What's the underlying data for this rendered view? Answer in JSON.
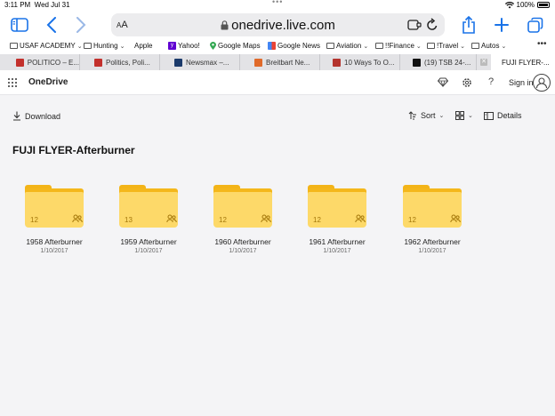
{
  "status": {
    "time": "3:11 PM",
    "date": "Wed Jul 31",
    "battery": "100%",
    "dots": "•••"
  },
  "browser": {
    "aa_small": "A",
    "aa_big": "A",
    "url": "onedrive.live.com",
    "icons": [
      "sidebar-icon",
      "back-icon",
      "forward-icon",
      "extension-icon",
      "reload-icon",
      "share-icon",
      "new-tab-icon",
      "tabs-icon"
    ]
  },
  "bookmarks": [
    {
      "label": "USAF ACADEMY",
      "type": "folder"
    },
    {
      "label": "Hunting",
      "type": "folder"
    },
    {
      "label": "Apple",
      "type": "apple"
    },
    {
      "label": "Yahoo!",
      "type": "yahoo"
    },
    {
      "label": "Google Maps",
      "type": "maps"
    },
    {
      "label": "Google News",
      "type": "news"
    },
    {
      "label": "Aviation",
      "type": "folder"
    },
    {
      "label": "!!Finance",
      "type": "folder"
    },
    {
      "label": "!Travel",
      "type": "folder"
    },
    {
      "label": "Autos",
      "type": "folder"
    }
  ],
  "bookmarks_more": "•••",
  "tabs": [
    {
      "label": "POLITICO – E...",
      "color": "#c3302c"
    },
    {
      "label": "Politics, Poli...",
      "color": "#c3302c"
    },
    {
      "label": "Newsmax –...",
      "color": "#1b3a6b"
    },
    {
      "label": "Breitbart Ne...",
      "color": "#e06a2a"
    },
    {
      "label": "10 Ways To O...",
      "color": "#b4342e"
    },
    {
      "label": "(19) TSB 24-...",
      "color": "#111111"
    },
    {
      "label": "FUJI FLYER-...",
      "color": "#ffffff"
    }
  ],
  "tab_close": "✕",
  "onedrive": {
    "brand": "OneDrive",
    "signin": "Sign in",
    "download": "Download",
    "sort": "Sort",
    "details": "Details",
    "folder_title": "FUJI FLYER-Afterburner"
  },
  "folders": [
    {
      "name": "1958 Afterburner",
      "date": "1/10/2017",
      "count": "12"
    },
    {
      "name": "1959 Afterburner",
      "date": "1/10/2017",
      "count": "13"
    },
    {
      "name": "1960 Afterburner",
      "date": "1/10/2017",
      "count": "12"
    },
    {
      "name": "1961 Afterburner",
      "date": "1/10/2017",
      "count": "12"
    },
    {
      "name": "1962 Afterburner",
      "date": "1/10/2017",
      "count": "12"
    }
  ],
  "colors": {
    "accent": "#1a73e8",
    "folder": "#fdd969",
    "folder_tab": "#f3b418"
  }
}
